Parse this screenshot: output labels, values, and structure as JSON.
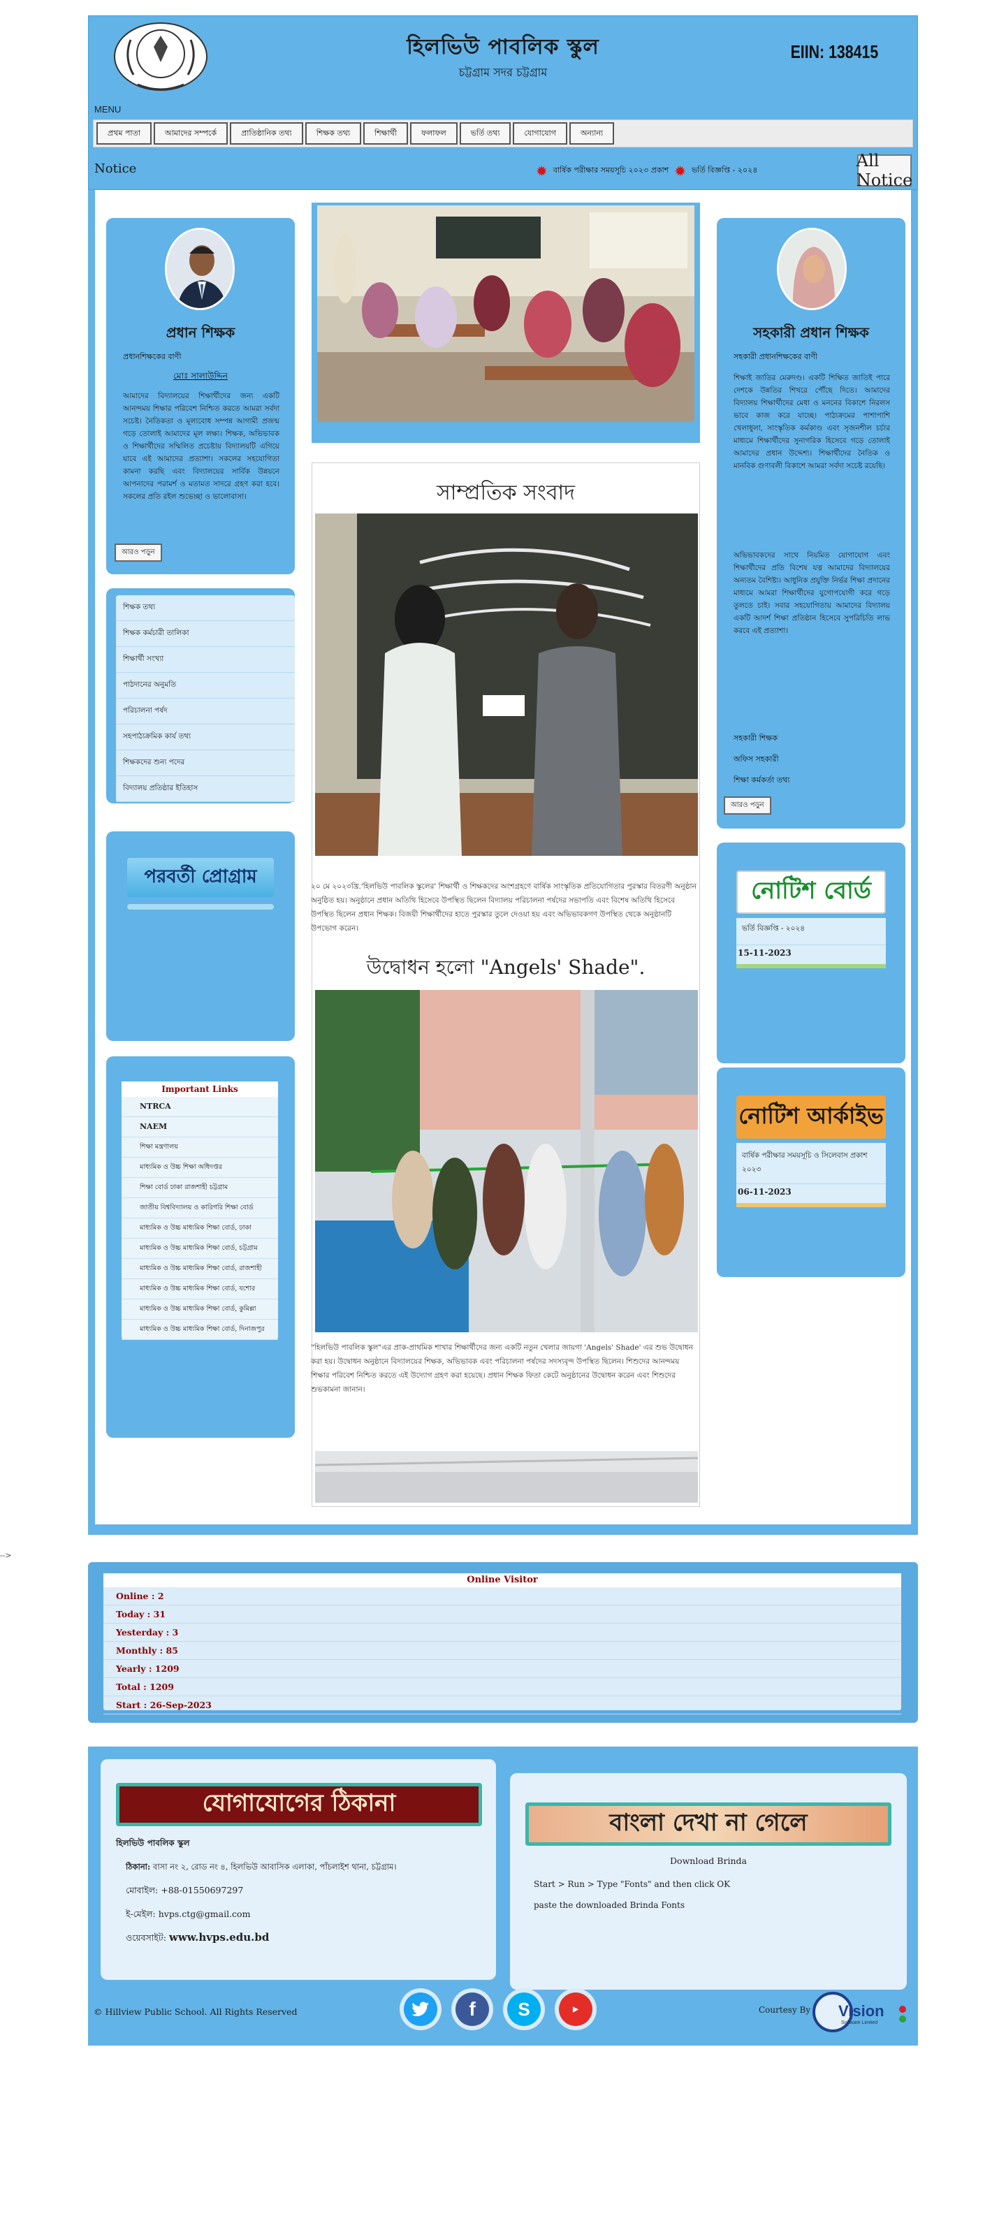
{
  "header": {
    "title": "হিলভিউ পাবলিক স্কুল",
    "subtitle": "চট্টগ্রাম সদর চট্টগ্রাম",
    "eiin": "EIIN:  138415",
    "menu_label": "MENU"
  },
  "menu": [
    "প্রথম পাতা",
    "আমাদের সম্পর্কে",
    "প্রাতিষ্ঠানিক তথ্য",
    "শিক্ষক তথ্য",
    "শিক্ষার্থী",
    "ফলাফল",
    "ভর্তি তথ্য",
    "যোগাযোগ",
    "অন্যান্য"
  ],
  "notice": {
    "label": "Notice",
    "items": [
      "বার্ষিক পরীক্ষার সময়সূচি ২০২৩ প্রকাশ",
      "ভর্তি বিজ্ঞপ্তি - ২০২৪"
    ],
    "all_button": "All Notice"
  },
  "stray_comment": "-->",
  "stray_comment_2": "-->",
  "head_teacher": {
    "name": "প্রধান শিক্ষক",
    "role": "প্রধানশিক্ষকের বাণী",
    "name_link": "মোঃ সালাউদ্দিন",
    "message": "আমাদের বিদ্যালয়ের শিক্ষার্থীদের জন্য একটি আনন্দময় শিক্ষার পরিবেশ নিশ্চিত করতে আমরা সর্বদা সচেষ্ট। নৈতিকতা ও মূল্যবোধ সম্পন্ন আগামী প্রজন্ম গড়ে তোলাই আমাদের মূল লক্ষ্য। শিক্ষক, অভিভাবক ও শিক্ষার্থীদের সম্মিলিত প্রচেষ্টায় বিদ্যালয়টি এগিয়ে যাবে এই আমাদের প্রত্যাশা। সকলের সহযোগিতা কামনা করছি এবং বিদ্যালয়ের সার্বিক উন্নয়নে আপনাদের পরামর্শ ও মতামত সাদরে গ্রহণ করা হবে। সকলের প্রতি রইল শুভেচ্ছা ও ভালোবাসা।",
    "more": "আরও পড়ুন"
  },
  "side_menu": [
    "শিক্ষক তথ্য",
    "শিক্ষক কর্মচারী তালিকা",
    "শিক্ষার্থী সংখ্যা",
    "পাঠদানের অনুমতি",
    "পরিচালনা পর্ষদ",
    "সহপাঠ্যক্রমিক কার্য তথ্য",
    "শিক্ষকদের শুন্য পদের",
    "বিদ্যালয় প্রতিষ্ঠার ইতিহাস"
  ],
  "program_banner": "পরবর্তী প্রোগ্রাম",
  "important_links": {
    "title": "Important Links",
    "items": [
      "NTRCA",
      "NAEM",
      "শিক্ষা মন্ত্রণালয়",
      "মাধ্যমিক ও উচ্চ শিক্ষা অধিদপ্তর",
      "শিক্ষা বোর্ড ঢাকা রাজশাহী চট্টগ্রাম",
      "জাতীয় বিশ্ববিদ্যালয় ও কারিগরি শিক্ষা বোর্ড",
      "মাধ্যমিক ও উচ্চ মাধ্যমিক শিক্ষা বোর্ড, ঢাকা",
      "মাধ্যমিক ও উচ্চ মাধ্যমিক শিক্ষা বোর্ড, চট্টগ্রাম",
      "মাধ্যমিক ও উচ্চ মাধ্যমিক শিক্ষা বোর্ড, রাজশাহী",
      "মাধ্যমিক ও উচ্চ মাধ্যমিক শিক্ষা বোর্ড, যশোর",
      "মাধ্যমিক ও উচ্চ মাধ্যমিক শিক্ষা বোর্ড, কুমিল্লা",
      "মাধ্যমিক ও উচ্চ মাধ্যমিক শিক্ষা বোর্ড, দিনাজপুর"
    ]
  },
  "center": {
    "news_title": "সাম্প্রতিক সংবাদ",
    "para1": "২০ মে ২০২৩খ্রি.'হিলভিউ পাবলিক স্কুলের' শিক্ষার্থী ও শিক্ষকদের অংশগ্রহণে বার্ষিক সাংস্কৃতিক প্রতিযোগিতার পুরস্কার বিতরণী অনুষ্ঠান অনুষ্ঠিত হয়। অনুষ্ঠানে প্রধান অতিথি হিসেবে উপস্থিত ছিলেন বিদ্যালয় পরিচালনা পর্ষদের সভাপতি এবং বিশেষ অতিথি হিসেবে উপস্থিত ছিলেন প্রধান শিক্ষক। বিজয়ী শিক্ষার্থীদের হাতে পুরস্কার তুলে দেওয়া হয় এবং অভিভাবকগণ উপস্থিত থেকে অনুষ্ঠানটি উপভোগ করেন।",
    "shade_title": "উদ্বোধন হলো \"Angels' Shade\".",
    "para2": "\"হিলভিউ পাবলিক স্কুল\"এর প্রাক-প্রাথমিক শাখার শিক্ষার্থীদের জন্য একটি নতুন খেলার জায়গা 'Angels' Shade' এর শুভ উদ্বোধন করা হয়। উদ্বোধন অনুষ্ঠানে বিদ্যালয়ের শিক্ষক, অভিভাবক এবং পরিচালনা পর্ষদের সদস্যবৃন্দ উপস্থিত ছিলেন। শিশুদের আনন্দময় শিক্ষার পরিবেশ নিশ্চিত করতে এই উদ্যোগ গ্রহণ করা হয়েছে। প্রধান শিক্ষক ফিতা কেটে অনুষ্ঠানের উদ্বোধন করেন এবং শিশুদের শুভকামনা জানান।"
  },
  "assistant_head": {
    "name": "সহকারী প্রধান শিক্ষক",
    "role": "সহকারী প্রধানশিক্ষকের বাণী",
    "message1": "শিক্ষাই জাতির মেরুদণ্ড। একটি শিক্ষিত জাতিই পারে দেশকে উন্নতির শিখরে পৌঁছে দিতে। আমাদের বিদ্যালয় শিক্ষার্থীদের মেধা ও মননের বিকাশে নিরলস ভাবে কাজ করে যাচ্ছে। পাঠ্যক্রমের পাশাপাশি খেলাধুলা, সাংস্কৃতিক কর্মকাণ্ড এবং সৃজনশীল চর্চার মাধ্যমে শিক্ষার্থীদের সুনাগরিক হিসেবে গড়ে তোলাই আমাদের প্রধান উদ্দেশ্য। শিক্ষার্থীদের নৈতিক ও মানবিক গুণাবলী বিকাশে আমরা সর্বদা সচেষ্ট রয়েছি।",
    "message2": "অভিভাবকদের সাথে নিয়মিত যোগাযোগ এবং শিক্ষার্থীদের প্রতি বিশেষ যত্ন আমাদের বিদ্যালয়ের অন্যতম বৈশিষ্ট্য। আধুনিক প্রযুক্তি নির্ভর শিক্ষা প্রদানের মাধ্যমে আমরা শিক্ষার্থীদের যুগোপযোগী করে গড়ে তুলতে চাই। সবার সহযোগিতায় আমাদের বিদ্যালয় একটি আদর্শ শিক্ষা প্রতিষ্ঠান হিসেবে সুপরিচিতি লাভ করবে এই প্রত্যাশা।",
    "extra": [
      "সহকারী শিক্ষক",
      "অফিস সহকারী",
      "শিক্ষা কর্মকর্তা তথ্য"
    ],
    "more": "আরও পড়ুন"
  },
  "notice_board": {
    "banner": "নোটিশ বোর্ড",
    "item": "ভর্তি বিজ্ঞপ্তি - ২০২৪",
    "date": "15-11-2023"
  },
  "notice_archive": {
    "banner": "নোটিশ আর্কাইভ",
    "item": "বার্ষিক পরীক্ষার সময়সূচি ও সিলেবাস প্রকাশ ২০২৩",
    "date": "06-11-2023"
  },
  "visitor": {
    "title": "Online Visitor",
    "rows": [
      "Online : 2",
      "Today : 31",
      "Yesterday : 3",
      "Monthly : 85",
      "Yearly : 1209",
      "Total : 1209",
      "Start : 26-Sep-2023"
    ]
  },
  "contact": {
    "banner": "যোগাযোগের ঠিকানা",
    "school": "হিলভিউ পাবলিক স্কুল",
    "address_label": "ঠিকানা:",
    "address": "বাসা নং ২, রোড নং ৪, হিলভিউ আবাসিক এলাকা, পাঁচলাইশ থানা, চট্টগ্রাম।",
    "phone_label": "মোবাইল:",
    "phone": "+88-01550697297",
    "email_label": "ই-মেইল:",
    "email": "hvps.ctg@gmail.com",
    "web_label": "ওয়েবসাইট:",
    "website": "www.hvps.edu.bd"
  },
  "font_help": {
    "banner": "বাংলা দেখা না গেলে",
    "download": "Download Brinda",
    "line1": "Start > Run > Type \"Fonts\" and then click OK",
    "line2": "paste the downloaded Brinda Fonts"
  },
  "footer": {
    "copyright": "© Hillview Public School. All Rights Reserved",
    "courtesy": "Courtesy By",
    "vendor": "Vision",
    "vendor_sub": "Software Limited",
    "social": [
      "Twitter",
      "Facebook",
      "Skype",
      "YouTube"
    ]
  },
  "colors": {
    "page_blue": "#62b3e7",
    "dark_red": "#8b0000",
    "banner_green": "#1a8f2e",
    "banner_orange": "#f2a23a",
    "banner_maroon": "#7a1010"
  }
}
